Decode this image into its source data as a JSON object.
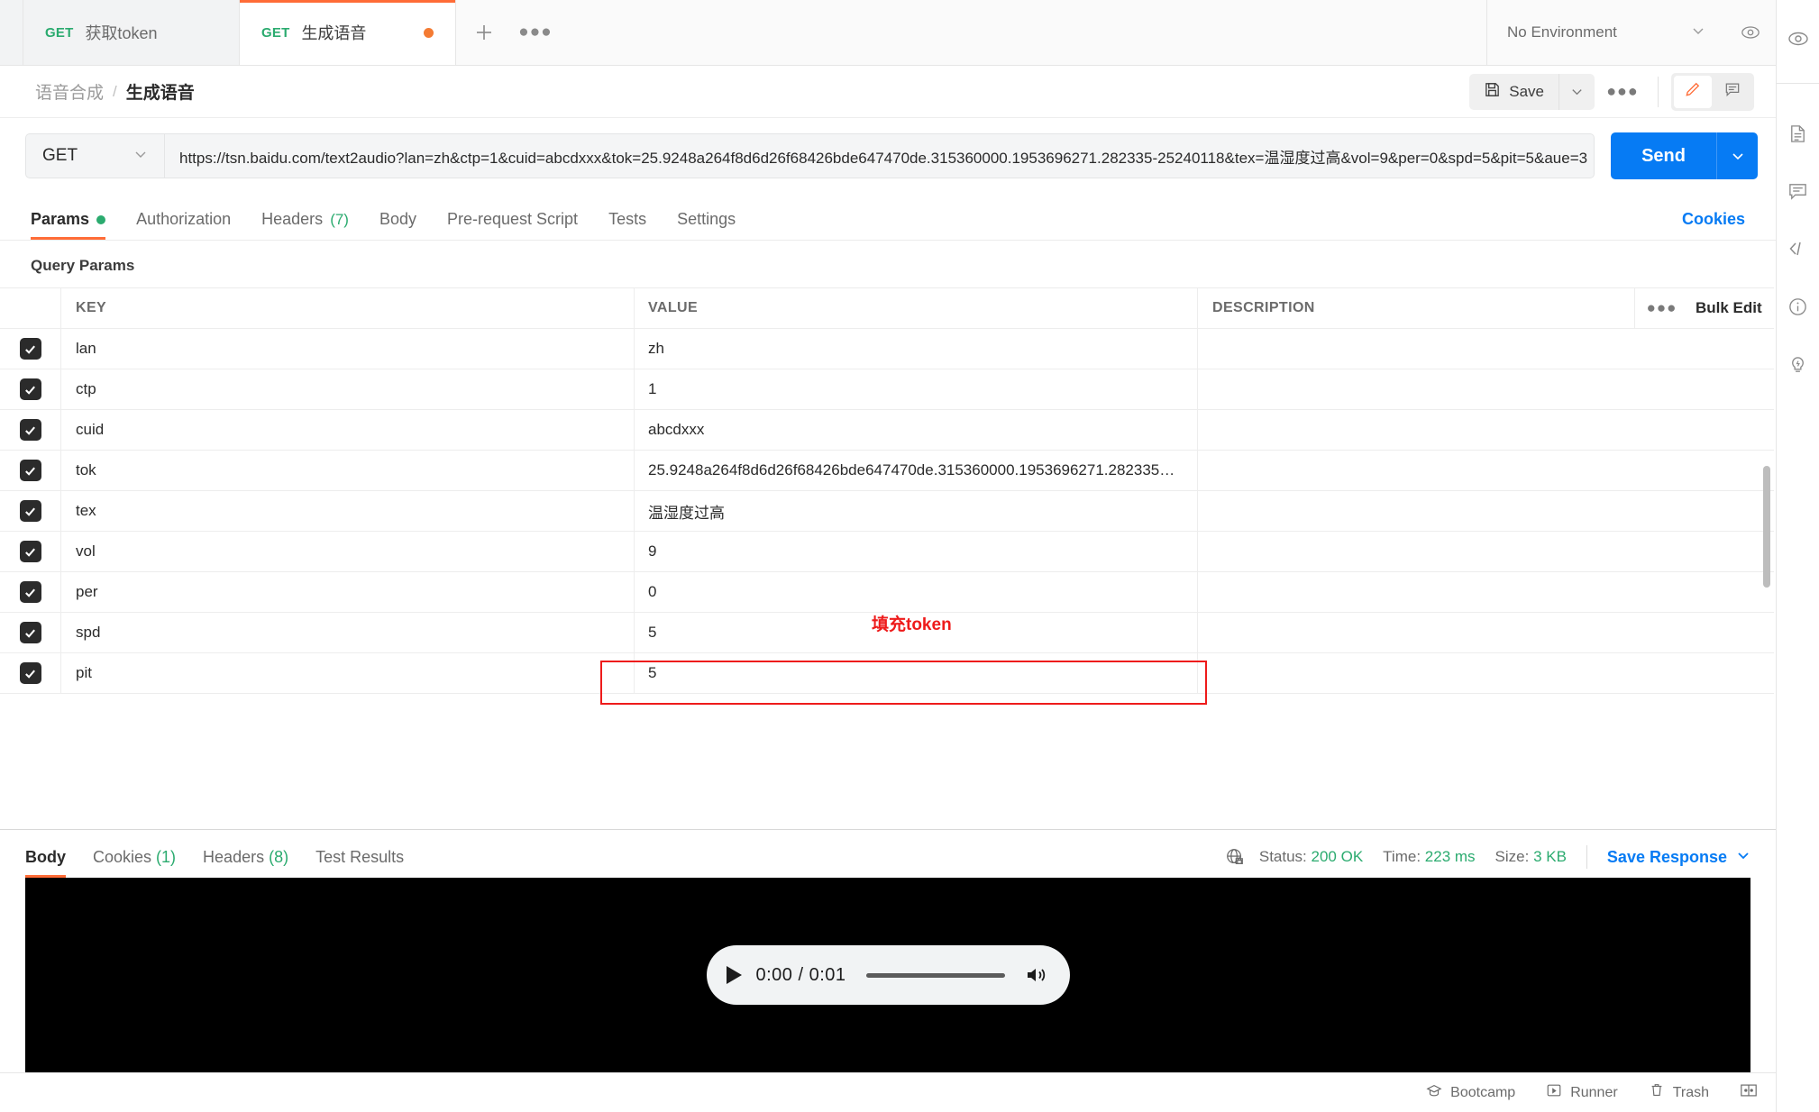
{
  "tabs": [
    {
      "method": "GET",
      "title": "获取token",
      "active": false,
      "dirty": false
    },
    {
      "method": "GET",
      "title": "生成语音",
      "active": true,
      "dirty": true
    }
  ],
  "tabbar": {
    "new_tab_label": "+",
    "more_label": "●●●",
    "environment": "No Environment"
  },
  "breadcrumb": {
    "collection": "语音合成",
    "separator": "/",
    "request": "生成语音"
  },
  "toolbar": {
    "save_label": "Save",
    "more_label": "●●●"
  },
  "request": {
    "method": "GET",
    "url": "https://tsn.baidu.com/text2audio?lan=zh&ctp=1&cuid=abcdxxx&tok=25.9248a264f8d6d26f68426bde647470de.315360000.1953696271.282335-25240118&tex=温湿度过高&vol=9&per=0&spd=5&pit=5&aue=3",
    "send_label": "Send"
  },
  "request_tabs": [
    {
      "label": "Params",
      "active": true,
      "dot": true
    },
    {
      "label": "Authorization",
      "active": false
    },
    {
      "label": "Headers",
      "count": "(7)",
      "active": false
    },
    {
      "label": "Body",
      "active": false
    },
    {
      "label": "Pre-request Script",
      "active": false
    },
    {
      "label": "Tests",
      "active": false
    },
    {
      "label": "Settings",
      "active": false
    }
  ],
  "cookies_link": "Cookies",
  "params": {
    "section_title": "Query Params",
    "columns": {
      "key": "KEY",
      "value": "VALUE",
      "description": "DESCRIPTION"
    },
    "actions_label": "●●●",
    "bulk_edit_label": "Bulk Edit",
    "rows": [
      {
        "checked": true,
        "key": "lan",
        "value": "zh",
        "description": ""
      },
      {
        "checked": true,
        "key": "ctp",
        "value": "1",
        "description": ""
      },
      {
        "checked": true,
        "key": "cuid",
        "value": "abcdxxx",
        "description": ""
      },
      {
        "checked": true,
        "key": "tok",
        "value": "25.9248a264f8d6d26f68426bde647470de.315360000.1953696271.282335…",
        "description": "",
        "highlighted": true
      },
      {
        "checked": true,
        "key": "tex",
        "value": "温湿度过高",
        "description": ""
      },
      {
        "checked": true,
        "key": "vol",
        "value": "9",
        "description": ""
      },
      {
        "checked": true,
        "key": "per",
        "value": "0",
        "description": ""
      },
      {
        "checked": true,
        "key": "spd",
        "value": "5",
        "description": ""
      },
      {
        "checked": true,
        "key": "pit",
        "value": "5",
        "description": ""
      }
    ]
  },
  "annotation": {
    "text": "填充token",
    "color": "#ee1b1b"
  },
  "response": {
    "tabs": [
      {
        "label": "Body",
        "active": true
      },
      {
        "label": "Cookies",
        "count": "(1)",
        "active": false
      },
      {
        "label": "Headers",
        "count": "(8)",
        "active": false
      },
      {
        "label": "Test Results",
        "active": false
      }
    ],
    "status_label": "Status:",
    "status_value": "200 OK",
    "time_label": "Time:",
    "time_value": "223 ms",
    "size_label": "Size:",
    "size_value": "3 KB",
    "save_response_label": "Save Response",
    "player": {
      "current_time": "0:00",
      "separator": "/",
      "duration": "0:01"
    }
  },
  "footer": {
    "bootcamp": "Bootcamp",
    "runner": "Runner",
    "trash": "Trash"
  },
  "colors": {
    "accent": "#ff6c37",
    "send_blue": "#067bf4",
    "green": "#2bab6f",
    "annotation_red": "#ee1b1b"
  }
}
